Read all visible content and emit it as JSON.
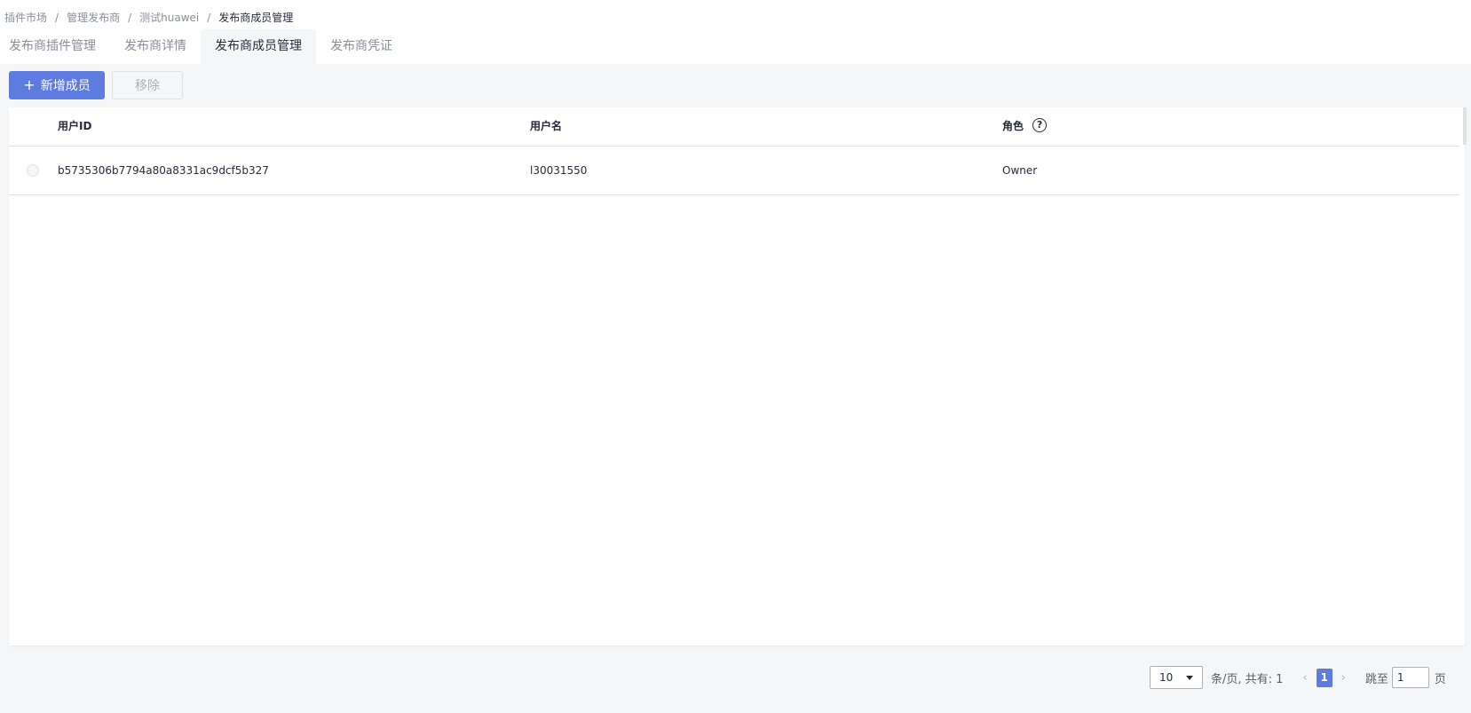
{
  "breadcrumb": {
    "items": [
      "插件市场",
      "管理发布商",
      "测试huawei",
      "发布商成员管理"
    ],
    "separator": "/"
  },
  "tabs": [
    {
      "label": "发布商插件管理",
      "active": false
    },
    {
      "label": "发布商详情",
      "active": false
    },
    {
      "label": "发布商成员管理",
      "active": true
    },
    {
      "label": "发布商凭证",
      "active": false
    }
  ],
  "toolbar": {
    "add_icon": "+",
    "add_label": "新增成员",
    "remove_label": "移除"
  },
  "table": {
    "columns": [
      {
        "label": "用户ID"
      },
      {
        "label": "用户名"
      },
      {
        "label": "角色",
        "help_icon": "?"
      }
    ],
    "rows": [
      {
        "user_id": "b5735306b7794a80a8331ac9dcf5b327",
        "username": "l30031550",
        "role": "Owner",
        "selected": false
      }
    ]
  },
  "pagination": {
    "page_size": "10",
    "summary": "条/页,  共有: 1",
    "prev_icon": "‹",
    "current_page": "1",
    "next_icon": "›",
    "jump_label": "跳至",
    "jump_value": "1",
    "jump_unit": "页"
  },
  "colors": {
    "primary": "#5e7ce0",
    "text": "#252b3a",
    "muted": "#8a8e99",
    "background": "#f5f6f8",
    "border": "#dfe1e6"
  }
}
